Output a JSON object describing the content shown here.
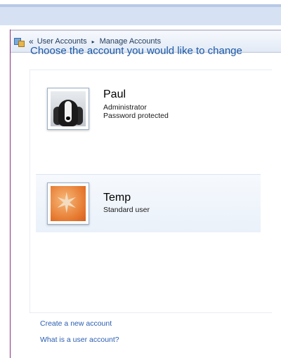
{
  "breadcrumb": {
    "back": "«",
    "items": [
      "User Accounts",
      "Manage Accounts"
    ],
    "separator": "▸"
  },
  "heading": "Choose the account you would like to change",
  "accounts": [
    {
      "name": "Paul",
      "line1": "Administrator",
      "line2": "Password protected",
      "avatar": "dog-picture"
    },
    {
      "name": "Temp",
      "line1": "Standard user",
      "avatar": "starfish-picture"
    }
  ],
  "links": {
    "create": "Create a new account",
    "what_is": "What is a user account?"
  },
  "colors": {
    "heading": "#1e5aa6",
    "link": "#2a5db0",
    "window_border": "#8b2f7e"
  }
}
